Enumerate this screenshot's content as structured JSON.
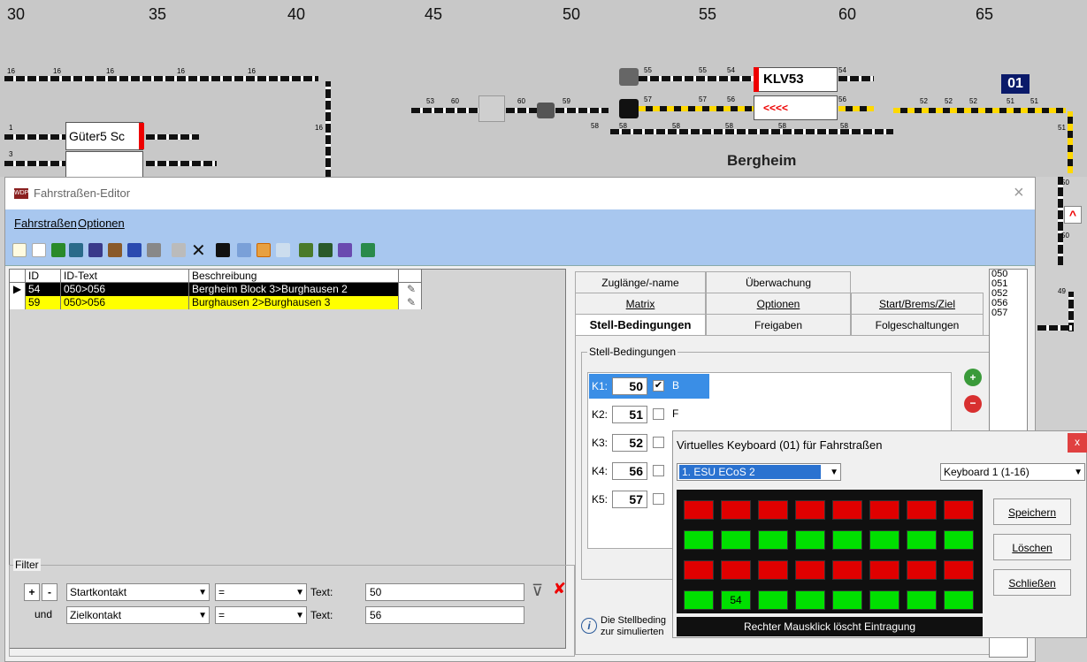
{
  "layout": {
    "ruler": [
      "30",
      "35",
      "40",
      "45",
      "50",
      "55",
      "60",
      "65"
    ],
    "signal_klv": "KLV53",
    "signal_arrows": "<<<<",
    "block_gueter": "Güter5 Sc",
    "station": "Bergheim",
    "badge": "01",
    "track_numbers": {
      "row16": "16",
      "n1": "1",
      "n3": "3",
      "n53": "53",
      "n60": "60",
      "n59": "59",
      "n55": "55",
      "n54": "54",
      "n57": "57",
      "n56": "56",
      "n58": "58",
      "n52": "52",
      "n51": "51",
      "n50": "50",
      "n49": "49"
    }
  },
  "window": {
    "title": "Fahrstraßen-Editor",
    "menu": [
      "Fahrstraßen",
      "Optionen"
    ]
  },
  "grid": {
    "columns": [
      "ID",
      "ID-Text",
      "Beschreibung"
    ],
    "rows": [
      {
        "id": "54",
        "idtext": "050>056",
        "desc": "Bergheim Block 3>Burghausen 2"
      },
      {
        "id": "59",
        "idtext": "050>056",
        "desc": "Burghausen 2>Burghausen 3"
      }
    ]
  },
  "filter": {
    "label": "Filter",
    "plus": "+",
    "minus": "-",
    "und": "und",
    "field1": "Startkontakt",
    "op1": "=",
    "text_label": "Text:",
    "value1": "50",
    "field2": "Zielkontakt",
    "op2": "=",
    "value2": "56"
  },
  "tabs": {
    "row1": [
      "Zuglänge/-name",
      "Überwachung"
    ],
    "row2": [
      "Matrix",
      "Optionen",
      "Start/Brems/Ziel"
    ],
    "row3": [
      "Stell-Bedingungen",
      "Freigaben",
      "Folgeschaltungen"
    ]
  },
  "stell": {
    "group": "Stell-Bedingungen",
    "rows": [
      {
        "k": "K1:",
        "v": "50",
        "checked": true,
        "flag": "B"
      },
      {
        "k": "K2:",
        "v": "51",
        "checked": false,
        "flag": "F"
      },
      {
        "k": "K3:",
        "v": "52",
        "checked": false,
        "flag": ""
      },
      {
        "k": "K4:",
        "v": "56",
        "checked": false,
        "flag": ""
      },
      {
        "k": "K5:",
        "v": "57",
        "checked": false,
        "flag": ""
      }
    ],
    "info_line1": "Die Stellbeding",
    "info_line2": "zur simulierten"
  },
  "idlist": [
    "050",
    "051",
    "052",
    "056",
    "057"
  ],
  "vk": {
    "title": "Virtuelles Keyboard (01) für Fahrstraßen",
    "close": "x",
    "device": "1. ESU ECoS 2",
    "keyboard": "Keyboard 1 (1-16)",
    "grid_rows": [
      [
        "red",
        "red",
        "red",
        "red",
        "red",
        "red",
        "red",
        "red"
      ],
      [
        "green",
        "green",
        "green",
        "green",
        "green",
        "green",
        "green",
        "green"
      ],
      [
        "red",
        "red",
        "red",
        "red",
        "red",
        "red",
        "red",
        "red"
      ],
      [
        "green",
        "green",
        "green",
        "green",
        "green",
        "green",
        "green",
        "green"
      ]
    ],
    "marked_label": "54",
    "buttons": [
      "Speichern",
      "Löschen",
      "Schließen"
    ],
    "status": "Rechter Mausklick löscht Eintragung",
    "colors": {
      "red": "#e00000",
      "green": "#00e000",
      "dark": "#101010"
    }
  }
}
